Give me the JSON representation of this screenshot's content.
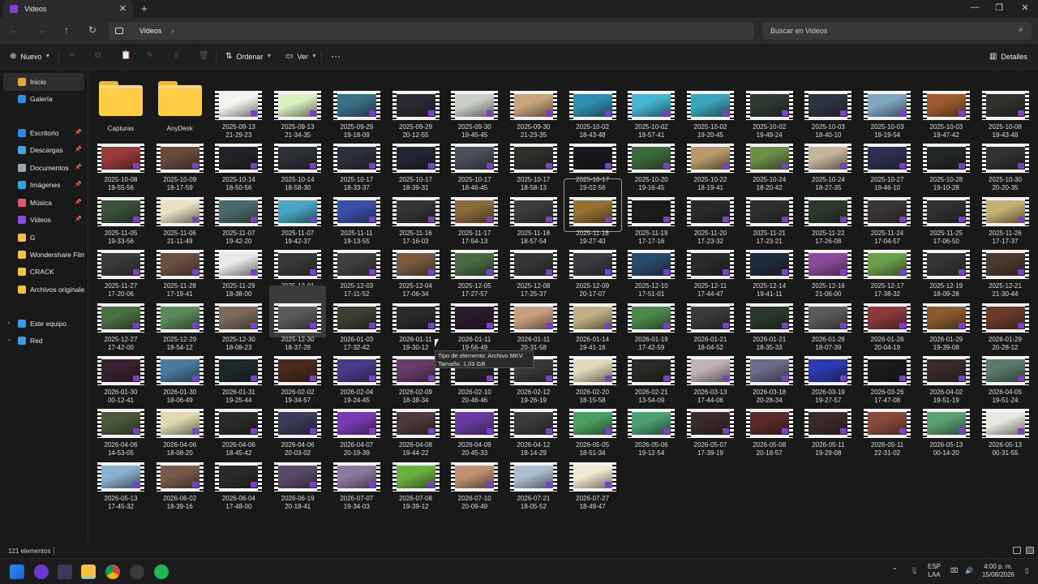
{
  "window": {
    "tab_title": "Videos"
  },
  "address": {
    "crumb": "Videos",
    "search_placeholder": "Buscar en Videos"
  },
  "toolbar": {
    "new_label": "Nuevo",
    "sort_label": "Ordenar",
    "view_label": "Ver",
    "more_label": "···",
    "details_label": "Detalles"
  },
  "sidebar": [
    {
      "label": "Inicio",
      "icon": "home-icon",
      "color": "#e8a33d",
      "selected": true
    },
    {
      "label": "Galería",
      "icon": "gallery-icon",
      "color": "#2d8fe0"
    },
    {
      "label": "Escritorio",
      "icon": "desktop-icon",
      "color": "#2c8be0",
      "pin": true
    },
    {
      "label": "Descargas",
      "icon": "download-icon",
      "color": "#3aa7e0",
      "pin": true
    },
    {
      "label": "Documentos",
      "icon": "document-icon",
      "color": "#9aa5b1",
      "pin": true
    },
    {
      "label": "Imágenes",
      "icon": "images-icon",
      "color": "#34a3e0",
      "pin": true
    },
    {
      "label": "Música",
      "icon": "music-icon",
      "color": "#e0566a",
      "pin": true
    },
    {
      "label": "Videos",
      "icon": "video-icon",
      "color": "#8a4de0",
      "pin": true
    },
    {
      "label": "G",
      "icon": "folder-icon",
      "color": "#f4c142"
    },
    {
      "label": "Wondershare Filmora",
      "icon": "folder-icon",
      "color": "#f4c142"
    },
    {
      "label": "CRACK",
      "icon": "folder-icon",
      "color": "#f4c142"
    },
    {
      "label": "Archivos originales",
      "icon": "folder-icon",
      "color": "#f4c142"
    },
    {
      "label": "Este equipo",
      "icon": "pc-icon",
      "color": "#3a9be0",
      "expand": true
    },
    {
      "label": "Red",
      "icon": "network-icon",
      "color": "#3a9be0",
      "expand": true
    }
  ],
  "folders": [
    "Capturas",
    "AnyDesk"
  ],
  "videos": [
    [
      "2025-09-13",
      "21-29-23",
      "#f4f4ee"
    ],
    [
      "2025-09-13",
      "21-34-35",
      "#d9f0c0"
    ],
    [
      "2025-09-29",
      "19-18-09",
      "#3a6f86"
    ],
    [
      "2025-09-29",
      "20-12-55",
      "#2a2a33"
    ],
    [
      "2025-09-30",
      "19-45-45",
      "#c9cfc7"
    ],
    [
      "2025-09-30",
      "21-23-35",
      "#c8a57a"
    ],
    [
      "2025-10-02",
      "18-43-48",
      "#2f8fb2"
    ],
    [
      "2025-10-02",
      "18-57-41",
      "#43b6d2"
    ],
    [
      "2025-10-02",
      "19-20-45",
      "#3aa5b8"
    ],
    [
      "2025-10-02",
      "19-49-24",
      "#2d3a32"
    ],
    [
      "2025-10-03",
      "18-40-10",
      "#2c3440"
    ],
    [
      "2025-10-03",
      "19-19-54",
      "#7ea7c4"
    ],
    [
      "2025-10-03",
      "19-47-42",
      "#9c5a2e"
    ],
    [
      "2025-10-08",
      "19-43-48",
      "#30302c"
    ],
    [
      "2025-10-08",
      "19-55-56",
      "#9b3a3a"
    ],
    [
      "2025-10-09",
      "18-17-59",
      "#6a4a3a"
    ],
    [
      "2025-10-14",
      "18-50-56",
      "#232327"
    ],
    [
      "2025-10-14",
      "18-58-30",
      "#2c3036"
    ],
    [
      "2025-10-17",
      "18-33-37",
      "#2d2f3a"
    ],
    [
      "2025-10-17",
      "18-39-31",
      "#232632"
    ],
    [
      "2025-10-17",
      "18-46-45",
      "#4a4f5a"
    ],
    [
      "2025-10-17",
      "18-58-13",
      "#2f2f2a"
    ],
    [
      "2025-10-17",
      "19-02-56",
      "#17171c"
    ],
    [
      "2025-10-20",
      "19-16-45",
      "#3d6a3a"
    ],
    [
      "2025-10-22",
      "18-19-41",
      "#b89a6a"
    ],
    [
      "2025-10-24",
      "18-20-42",
      "#6c8e4a"
    ],
    [
      "2025-10-24",
      "18-27-35",
      "#c4b49a"
    ],
    [
      "2025-10-27",
      "19-46-10",
      "#2c3050"
    ],
    [
      "2025-10-28",
      "19-10-28",
      "#232824"
    ],
    [
      "2025-10-30",
      "20-20-35",
      "#323230"
    ],
    [
      "2025-11-05",
      "19-33-56",
      "#3a5038"
    ],
    [
      "2025-11-06",
      "21-11-49",
      "#e8e0c0"
    ],
    [
      "2025-11-07",
      "19-42-20",
      "#4a6a6a"
    ],
    [
      "2025-11-07",
      "19-42-37",
      "#47a6c4"
    ],
    [
      "2025-11-11",
      "19-13-55",
      "#3a4fa8"
    ],
    [
      "2025-11-16",
      "17-16-03",
      "#343434"
    ],
    [
      "2025-11-17",
      "17-54-13",
      "#8a6a3a"
    ],
    [
      "2025-11-18",
      "18-57-54",
      "#3b3b3b"
    ],
    [
      "2025-11-18",
      "19-27-40",
      "#9a7030"
    ],
    [
      "2025-11-19",
      "17-17-16",
      "#1d1d1d"
    ],
    [
      "2025-11-20",
      "17-23-32",
      "#2a2a2a"
    ],
    [
      "2025-11-21",
      "17-23-21",
      "#2f2f2f"
    ],
    [
      "2025-11-22",
      "17-26-08",
      "#2c3a2c"
    ],
    [
      "2025-11-24",
      "17-04-57",
      "#3a3636"
    ],
    [
      "2025-11-25",
      "17-06-50",
      "#303030"
    ],
    [
      "2025-11-26",
      "17-17-37",
      "#c6b070"
    ],
    [
      "2025-11-27",
      "17-20-06",
      "#3a3a3a"
    ],
    [
      "2025-11-28",
      "17-19-41",
      "#6a5040"
    ],
    [
      "2025-11-29",
      "18-38-00",
      "#e8e8e8"
    ],
    [
      "2025-12-01",
      "17-27-17",
      "#383838"
    ],
    [
      "2025-12-03",
      "17-11-52",
      "#3f3f3f"
    ],
    [
      "2025-12-04",
      "17-06-34",
      "#7a5a40"
    ],
    [
      "2025-12-05",
      "17-27-57",
      "#4a6a40"
    ],
    [
      "2025-12-08",
      "17-25-37",
      "#363636"
    ],
    [
      "2025-12-09",
      "20-17-07",
      "#3a3a40"
    ],
    [
      "2025-12-10",
      "17-51-01",
      "#2a4a6a"
    ],
    [
      "2025-12-11",
      "17-44-47",
      "#2a2a2a"
    ],
    [
      "2025-12-14",
      "19-41-11",
      "#1f2a3a"
    ],
    [
      "2025-12-16",
      "21-06-00",
      "#8a4a9a"
    ],
    [
      "2025-12-17",
      "17-38-32",
      "#6aa04a"
    ],
    [
      "2025-12-19",
      "18-09-28",
      "#343434"
    ],
    [
      "2025-12-21",
      "21-30-44",
      "#4a3a30"
    ],
    [
      "2025-12-27",
      "17-42-00",
      "#4a7040"
    ],
    [
      "2025-12-29",
      "18-54-12",
      "#5a8a5a"
    ],
    [
      "2025-12-30",
      "18-08-23",
      "#7a6a5a"
    ],
    [
      "2025-12-30",
      "18-37-28",
      "#5a5a5a"
    ],
    [
      "2026-01-03",
      "17-32-42",
      "#3a4030"
    ],
    [
      "2026-01-11",
      "19-30-12",
      "#2a2a2a"
    ],
    [
      "2026-01-11",
      "19-56-49",
      "#2a1a2a"
    ],
    [
      "2026-01-11",
      "20-31-58",
      "#c8a080"
    ],
    [
      "2026-01-14",
      "19-41-16",
      "#c0b080"
    ],
    [
      "2026-01-19",
      "17-42-59",
      "#4a8a4a"
    ],
    [
      "2026-01-21",
      "18-04-52",
      "#3a3a3a"
    ],
    [
      "2026-01-21",
      "18-35-33",
      "#2a3a2a"
    ],
    [
      "2026-01-26",
      "18-07-39",
      "#5a5a5a"
    ],
    [
      "2026-01-26",
      "20-04-19",
      "#8a3a3a"
    ],
    [
      "2026-01-29",
      "19-39-08",
      "#8a5a2a"
    ],
    [
      "2026-01-29",
      "20-28-12",
      "#6a3a2a"
    ],
    [
      "2026-01-30",
      "00-12-41",
      "#3a2030"
    ],
    [
      "2026-01-30",
      "18-06-49",
      "#4a7aa0"
    ],
    [
      "2026-01-31",
      "19-25-44",
      "#1a2a2a"
    ],
    [
      "2026-02-02",
      "19-34-57",
      "#4a2a1a"
    ],
    [
      "2026-02-04",
      "19-24-45",
      "#4a3a8a"
    ],
    [
      "2026-02-09",
      "18-38-34",
      "#6a3a6a"
    ],
    [
      "2026-02-10",
      "20-46-46",
      "#222222"
    ],
    [
      "2026-02-12",
      "19-26-19",
      "#3a3a3a"
    ],
    [
      "2026-02-20",
      "18-15-58",
      "#e0d8b8"
    ],
    [
      "2026-02-21",
      "13-54-09",
      "#2a2a26"
    ],
    [
      "2026-03-13",
      "17-44-06",
      "#c0b0b8"
    ],
    [
      "2026-03-18",
      "20-28-34",
      "#6a6a8a"
    ],
    [
      "2026-03-19",
      "19-27-57",
      "#2a3ab0"
    ],
    [
      "2026-03-26",
      "17-47-08",
      "#1a1a1a"
    ],
    [
      "2026-04-02",
      "19-51-19",
      "#3a2a2a"
    ],
    [
      "2026-04-05",
      "19-51-24",
      "#5a7a6a"
    ],
    [
      "2026-04-06",
      "14-53-05",
      "#4a5a3a"
    ],
    [
      "2026-04-06",
      "18-08-20",
      "#e0d8b0"
    ],
    [
      "2026-04-06",
      "18-45-42",
      "#2a2a2a"
    ],
    [
      "2026-04-06",
      "20-03-02",
      "#3a3a5a"
    ],
    [
      "2026-04-07",
      "20-19-39",
      "#7a3ab0"
    ],
    [
      "2026-04-08",
      "19-44-22",
      "#4a3a3a"
    ],
    [
      "2026-04-09",
      "20-45-33",
      "#6a3aa0"
    ],
    [
      "2026-04-12",
      "18-14-29",
      "#3a3a3a"
    ],
    [
      "2026-05-05",
      "18-51-34",
      "#4aa060"
    ],
    [
      "2026-05-06",
      "19-12-54",
      "#4aa070"
    ],
    [
      "2026-05-07",
      "17-39-19",
      "#3a2a2a"
    ],
    [
      "2026-05-08",
      "20-18-57",
      "#5a2a2a"
    ],
    [
      "2026-05-11",
      "19-29-08",
      "#3a2a2a"
    ],
    [
      "2026-05-11",
      "22-31-02",
      "#8a4a3a"
    ],
    [
      "2026-05-13",
      "00-14-20",
      "#5aa070"
    ],
    [
      "2026-05-13",
      "00-31-55",
      "#e8e8e0"
    ],
    [
      "2026-05-13",
      "17-45-32",
      "#8ab0d0"
    ],
    [
      "2026-06-02",
      "18-39-16",
      "#7a5a4a"
    ],
    [
      "2026-06-04",
      "17-48-00",
      "#2a2a2a"
    ],
    [
      "2026-06-19",
      "20-18-41",
      "#5a4a6a"
    ],
    [
      "2026-07-07",
      "19-34-03",
      "#8a7aa0"
    ],
    [
      "2026-07-08",
      "19-39-12",
      "#6ab040"
    ],
    [
      "2026-07-10",
      "20-09-49",
      "#c09070"
    ],
    [
      "2026-07-21",
      "18-05-52",
      "#aac0d0"
    ],
    [
      "2026-07-27",
      "18-49-47",
      "#f0e8d0"
    ]
  ],
  "tooltip": {
    "line1": "Tipo de elemento: Archivo MKV",
    "line2": "Tamaño: 1,03 GB"
  },
  "status": {
    "count": "121 elementos"
  },
  "taskbar": {
    "lang1": "ESP",
    "lang2": "LAA",
    "time": "4:00 p. m.",
    "date": "15/08/2026"
  }
}
